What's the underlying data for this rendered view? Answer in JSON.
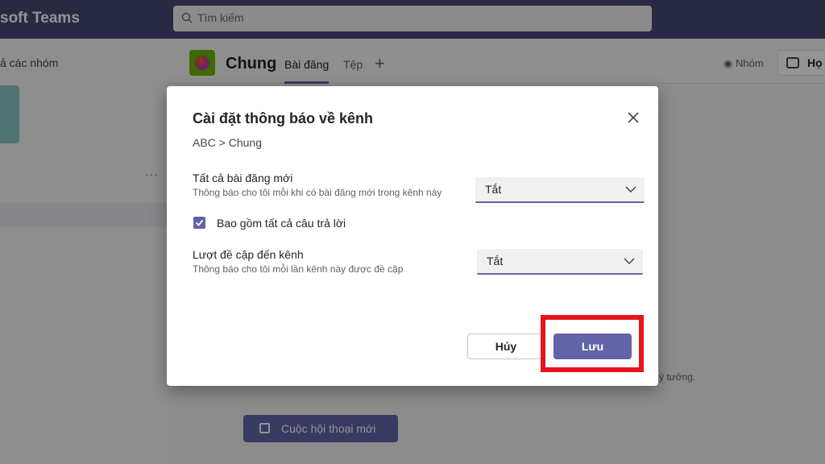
{
  "app": {
    "title": "soft Teams"
  },
  "search": {
    "placeholder": "Tìm kiếm"
  },
  "sidebar": {
    "all_teams_label": "ả các nhóm",
    "more": "···"
  },
  "channel": {
    "name": "Chung",
    "tabs": [
      {
        "label": "Bài đăng"
      },
      {
        "label": "Tệp"
      }
    ],
    "add_tab": "+",
    "team_label": "Nhóm",
    "meet_label": "Họ"
  },
  "content": {
    "tip_text": "ý tưởng.",
    "new_conversation_label": "Cuộc hội thoại mới"
  },
  "dialog": {
    "title": "Cài đặt thông báo về kênh",
    "breadcrumb": "ABC > Chung",
    "settings": [
      {
        "label": "Tất cả bài đăng mới",
        "description": "Thông báo cho tôi mỗi khi có bài đăng mới trong kênh này",
        "value": "Tắt"
      },
      {
        "label": "Lượt đề cập đến kênh",
        "description": "Thông báo cho tôi mỗi lần kênh này được đề cập",
        "value": "Tắt"
      }
    ],
    "include_replies": {
      "label": "Bao gồm tất cả câu trả lời",
      "checked": true
    },
    "cancel_label": "Hủy",
    "save_label": "Lưu"
  },
  "colors": {
    "brand": "#6264a7",
    "topbar": "#464775",
    "highlight": "#e8141c"
  }
}
